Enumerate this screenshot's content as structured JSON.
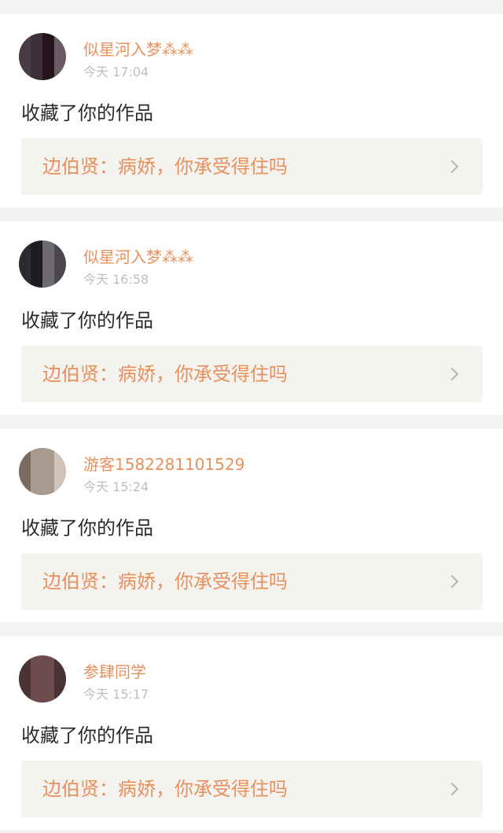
{
  "notifications": [
    {
      "user": "似星河入梦⁂⁂",
      "time": "今天 17:04",
      "action": "收藏了你的作品",
      "work": "边伯贤：病娇，你承受得住吗",
      "avatar_colors": [
        "#3c2f37",
        "#24151d",
        "#4a3a44",
        "#6b5a63"
      ]
    },
    {
      "user": "似星河入梦⁂⁂",
      "time": "今天 16:58",
      "action": "收藏了你的作品",
      "work": "边伯贤：病娇，你承受得住吗",
      "avatar_colors": [
        "#2d2a31",
        "#1e1b22",
        "#4b474e",
        "#6e6a70"
      ]
    },
    {
      "user": "游客1582281101529",
      "time": "今天 15:24",
      "action": "收藏了你的作品",
      "work": "边伯贤：病娇，你承受得住吗",
      "avatar_colors": [
        "#cfc2b6",
        "#7a6c62",
        "#a89a8e",
        "#e7dfd6"
      ]
    },
    {
      "user": "参肆同学",
      "time": "今天 15:17",
      "action": "收藏了你的作品",
      "work": "边伯贤：病娇，你承受得住吗",
      "avatar_colors": [
        "#6e4c4e",
        "#b88b88",
        "#e6c6c4",
        "#4b3335"
      ]
    }
  ],
  "colors": {
    "accent": "#e8905c",
    "time": "#bdbdbd",
    "text": "#2b2b2b",
    "box": "#f4f3ef",
    "divider": "#f3f3f3"
  },
  "icons": {
    "chevron": "chevron-right-icon"
  }
}
